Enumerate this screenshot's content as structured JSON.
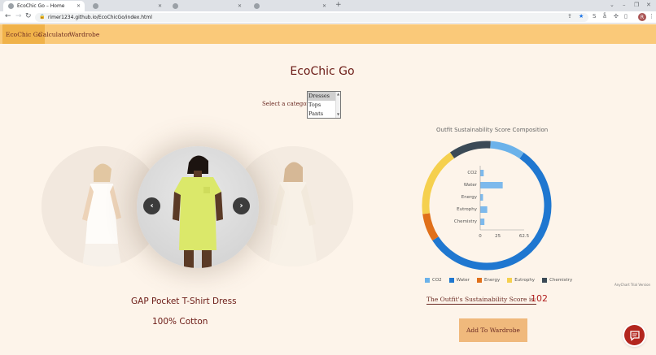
{
  "browser": {
    "tabs": [
      {
        "title": "EcoChic Go – Home",
        "active": true
      },
      {
        "title": "",
        "active": false
      },
      {
        "title": "",
        "active": false
      },
      {
        "title": "",
        "active": false
      }
    ],
    "new_tab": "+",
    "url": "rimer1234.github.io/EcoChicGo/index.html",
    "profile_initial": "R"
  },
  "nav": {
    "items": [
      "EcoChic Go",
      "Calculator",
      "Wardrobe"
    ],
    "active": "EcoChic Go"
  },
  "page": {
    "title": "EcoChic Go",
    "category_label": "Select a category:",
    "category_options": [
      "Dresses",
      "Tops",
      "Pants"
    ],
    "selected_category": "Dresses"
  },
  "product": {
    "name": "GAP Pocket T-Shirt Dress",
    "material": "100% Cotton",
    "prev_arrow": "‹",
    "next_arrow": "›"
  },
  "chart_data": {
    "type": "bar",
    "title": "Outfit Sustainability Score Composition",
    "categories": [
      "CO2",
      "Water",
      "Energy",
      "Eutrophy",
      "Chemistry"
    ],
    "values": [
      5,
      32,
      4,
      10,
      6
    ],
    "xticks": [
      "0",
      "25",
      "62.5"
    ],
    "xlim": [
      0,
      62.5
    ],
    "ring": {
      "labels": [
        "CO2",
        "Water",
        "Energy",
        "Eutrophy",
        "Chemistry"
      ],
      "values": [
        5,
        32,
        4,
        10,
        6
      ]
    },
    "legend_position": "bottom",
    "colors": [
      "#6bb2ea",
      "#1f77d0",
      "#e0701a",
      "#f5d04e",
      "#3b4a56"
    ],
    "credit": "AnyChart Trial Version"
  },
  "score": {
    "label": "The Outfit's Sustainability Score is:",
    "value": "102"
  },
  "actions": {
    "add_to_wardrobe": "Add To Wardrobe"
  },
  "colors": {
    "nav_bg": "#fac979",
    "nav_active": "#f0b24a",
    "page_bg": "#fdf4ea",
    "title_color": "#6b1a15",
    "button_bg": "#f0b97c",
    "score_color": "#b01d1d",
    "chat_bg": "#b3261e"
  }
}
